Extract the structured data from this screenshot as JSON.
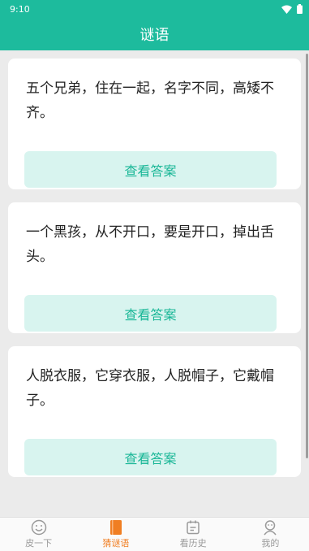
{
  "status_bar": {
    "time": "9:10",
    "wifi_icon": "wifi-icon",
    "battery_icon": "battery-icon"
  },
  "app_bar": {
    "title": "谜语"
  },
  "riddles": [
    {
      "text": "五个兄弟，住在一起，名字不同，高矮不齐。",
      "button": "查看答案"
    },
    {
      "text": "一个黑孩，从不开口，要是开口，掉出舌头。",
      "button": "查看答案"
    },
    {
      "text": "人脱衣服，它穿衣服，人脱帽子，它戴帽子。",
      "button": "查看答案"
    }
  ],
  "tabs": [
    {
      "label": "皮一下",
      "icon": "smile-icon",
      "active": false
    },
    {
      "label": "猜谜语",
      "icon": "book-icon",
      "active": true
    },
    {
      "label": "看历史",
      "icon": "calendar-icon",
      "active": false
    },
    {
      "label": "我的",
      "icon": "person-icon",
      "active": false
    }
  ],
  "colors": {
    "primary": "#1dbb9d",
    "active_tab": "#f07e22",
    "button_bg": "#d8f4ef"
  }
}
